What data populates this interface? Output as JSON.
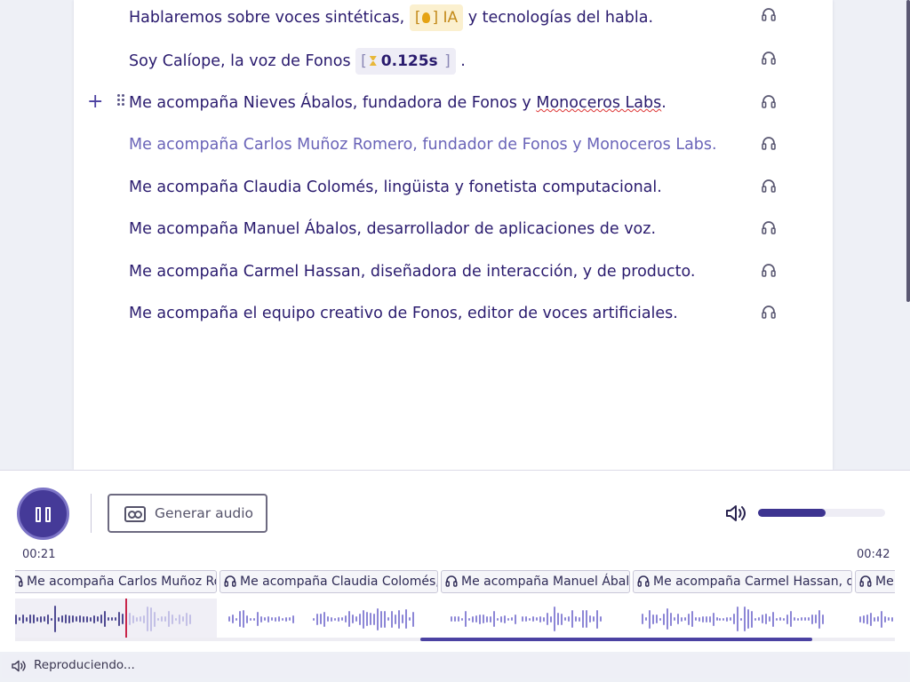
{
  "document": {
    "lines": [
      {
        "pre": "Hablaremos sobre voces sintéticas, ",
        "tag": "IA",
        "post": " y tecnologías del habla."
      },
      {
        "pre": "Soy Calíope, la voz de Fonos ",
        "pause": "0.125s",
        "post": " ."
      },
      {
        "pre": "Me acompaña Nieves Ábalos, fundadora de Fonos y ",
        "err": "Monoceros Labs",
        "post": "."
      },
      {
        "text": "Me acompaña Carlos Muñoz Romero, fundador de Fonos y Monoceros Labs."
      },
      {
        "text": "Me acompaña Claudia Colomés, lingüista y fonetista computacional."
      },
      {
        "text": "Me acompaña Manuel Ábalos, desarrollador de aplicaciones de voz."
      },
      {
        "text": "Me acompaña Carmel Hassan, diseñadora de interacción, y de producto."
      },
      {
        "text": "Me acompaña el equipo creativo de Fonos, editor de voces artificiales."
      }
    ],
    "add_symbol": "+",
    "bracket_open": "[",
    "bracket_close": "]"
  },
  "player": {
    "generate_label": "Generar audio",
    "volume_level": 0.53,
    "time_current": "00:21",
    "time_total": "00:42",
    "playing": true
  },
  "clips": [
    "Me acompaña Carlos Muñoz Romero, fundador de Fonos y Monoceros Labs.",
    "Me acompaña Claudia Colomés, lingüista y fonetista computacional.",
    "Me acompaña Manuel Ábalos, desarrollador de aplicaciones de voz.",
    "Me acompaña Carmel Hassan, diseñadora de interacción, y de producto.",
    "Me acompaña el equipo creativo de Fonos, editor de voces artificiales."
  ],
  "status": {
    "text": "Reproduciendo..."
  },
  "colors": {
    "accent": "#453a98",
    "text": "#2a1b6e",
    "selected": "#6a64b8",
    "playhead": "#c8254a",
    "tag_ia_bg": "#fbf0cf"
  }
}
